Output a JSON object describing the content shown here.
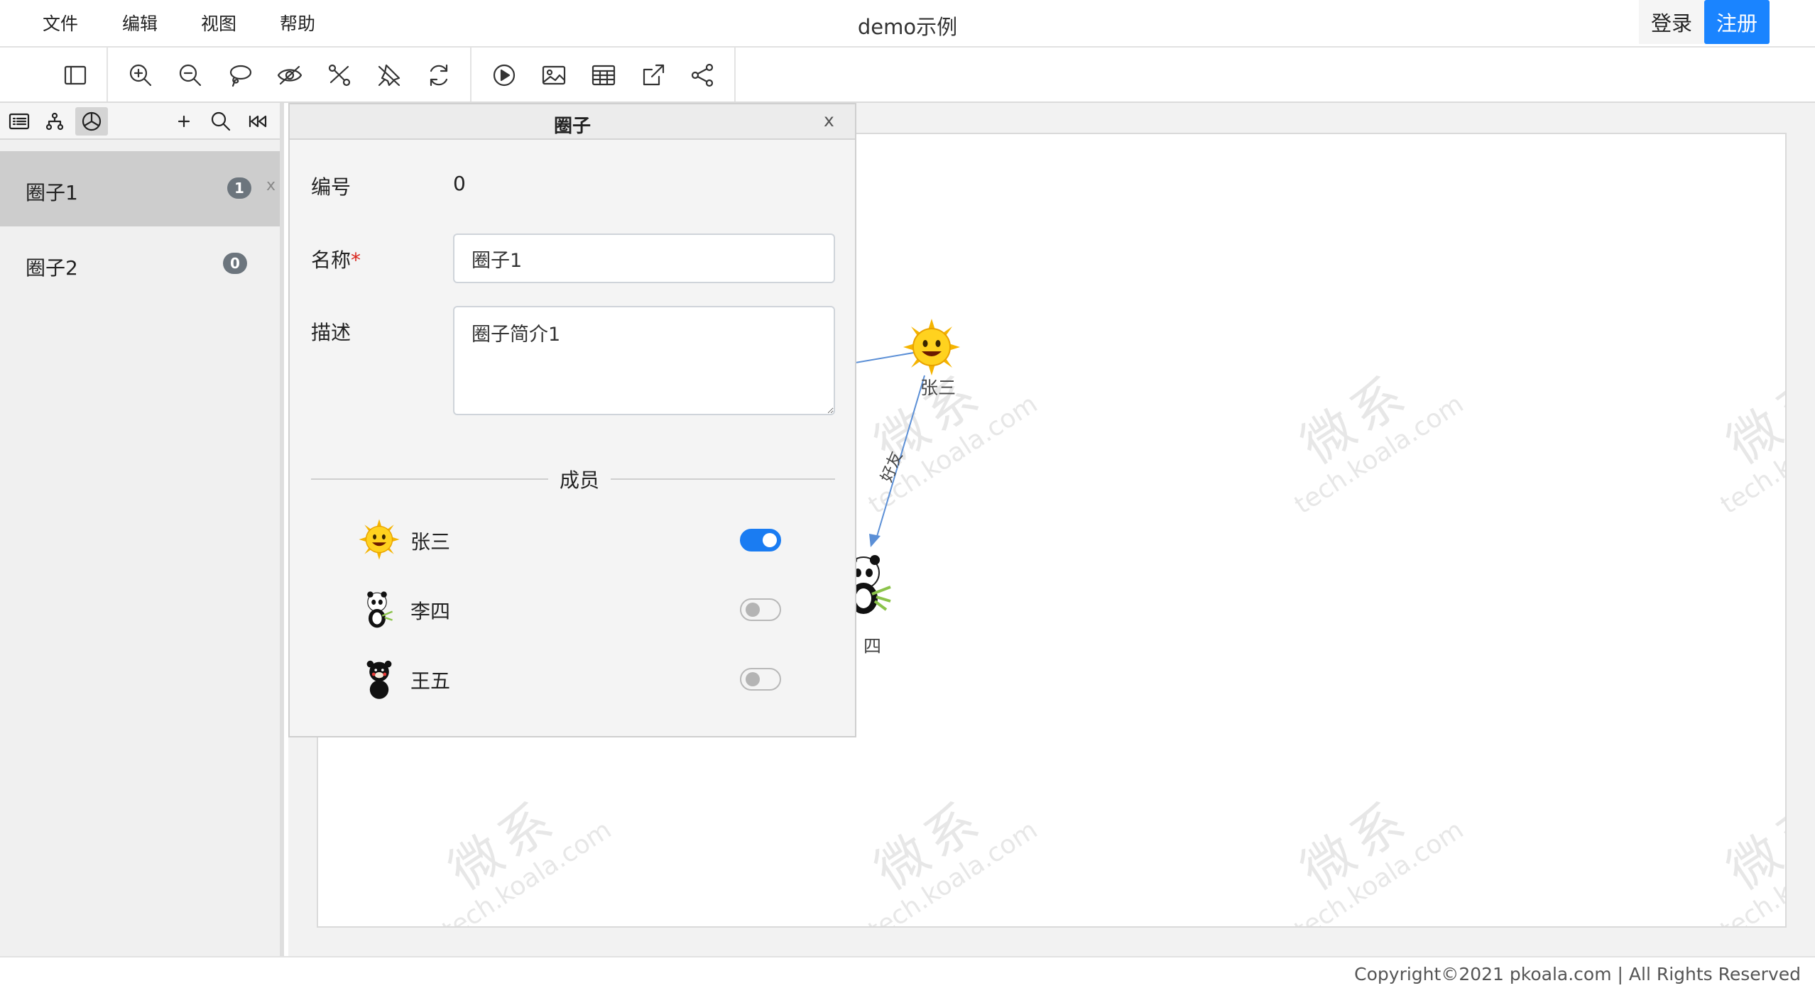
{
  "menubar": {
    "items": [
      {
        "label": "文件"
      },
      {
        "label": "编辑"
      },
      {
        "label": "视图"
      },
      {
        "label": "帮助"
      }
    ],
    "title": "demo示例",
    "login_label": "登录",
    "register_label": "注册"
  },
  "toolbar": {
    "buttons": [
      {
        "icon": "sidebar-toggle-icon"
      },
      {
        "icon": "zoom-in-icon"
      },
      {
        "icon": "zoom-out-icon"
      },
      {
        "icon": "lasso-icon"
      },
      {
        "icon": "eye-off-icon"
      },
      {
        "icon": "hide-edge-icon"
      },
      {
        "icon": "pin-off-icon"
      },
      {
        "icon": "refresh-icon"
      },
      {
        "icon": "play-icon"
      },
      {
        "icon": "image-icon"
      },
      {
        "icon": "table-icon"
      },
      {
        "icon": "export-icon"
      },
      {
        "icon": "share-icon"
      }
    ]
  },
  "left_panel": {
    "tabs": [
      {
        "icon": "list-icon"
      },
      {
        "icon": "hierarchy-icon"
      },
      {
        "icon": "pie-chart-icon",
        "active": true
      }
    ],
    "actions": [
      {
        "icon": "add-icon"
      },
      {
        "icon": "search-icon"
      },
      {
        "icon": "rewind-icon"
      }
    ],
    "circles": [
      {
        "name": "圈子1",
        "count": "1",
        "selected": true,
        "close": "x"
      },
      {
        "name": "圈子2",
        "count": "0",
        "selected": false
      }
    ]
  },
  "graph": {
    "nodes": [
      {
        "label": "张三",
        "avatar": "sun-avatar"
      },
      {
        "label": "四",
        "avatar": "panda-avatar"
      }
    ],
    "edges": [
      {
        "label": "好友"
      }
    ],
    "watermark": {
      "main": "微系",
      "sub": "tech.koala.com"
    }
  },
  "dialog": {
    "title": "圈子",
    "close": "x",
    "fields": {
      "id_label": "编号",
      "id_value": "0",
      "name_label": "名称",
      "name_required": "*",
      "name_value": "圈子1",
      "desc_label": "描述",
      "desc_value": "圈子简介1"
    },
    "members_title": "成员",
    "members": [
      {
        "name": "张三",
        "avatar": "sun-avatar",
        "enabled": true
      },
      {
        "name": "李四",
        "avatar": "panda-avatar",
        "enabled": false
      },
      {
        "name": "王五",
        "avatar": "bear-avatar",
        "enabled": false
      }
    ]
  },
  "footer": {
    "copyright": "Copyright©2021 pkoala.com | All Rights Reserved"
  },
  "colors": {
    "accent": "#1a84ff",
    "edge": "#5b8fd6",
    "badge": "#6c757d",
    "required": "#d9241c"
  }
}
